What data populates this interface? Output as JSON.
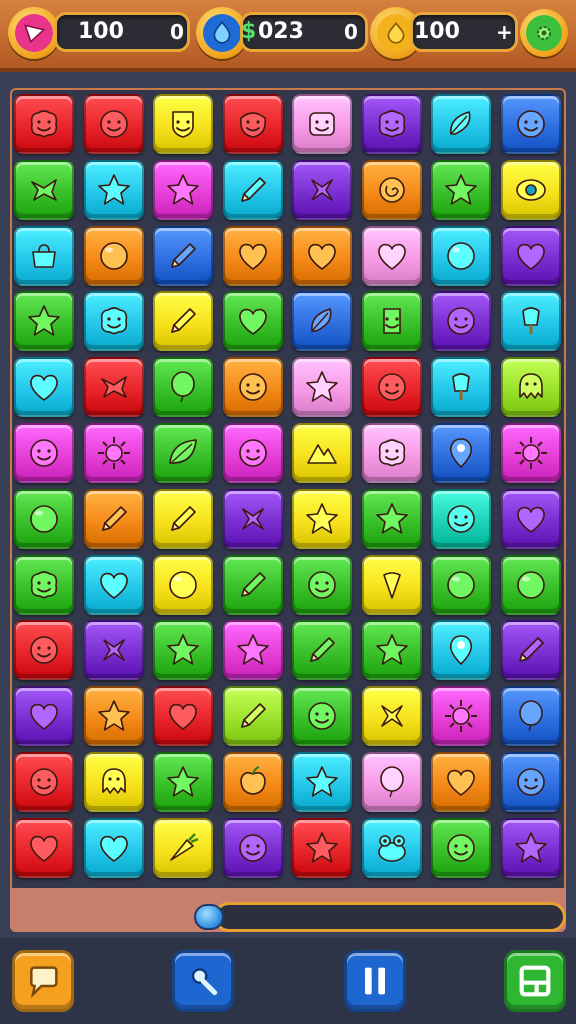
{
  "hud": {
    "moves_value": "100",
    "moves_end": "0",
    "gems_value": "023",
    "gems_prefix": "$",
    "gems_end": "0",
    "coins_value": "100",
    "coins_end": "+"
  },
  "progress": {
    "fraction": 0.0
  },
  "colors": {
    "red": "#e8252a",
    "orange": "#f58a1a",
    "yellow": "#f7e21d",
    "green": "#39c02b",
    "cyan": "#25c7ea",
    "blue": "#2f6fe0",
    "purple": "#7a2fd0",
    "magenta": "#e640d8",
    "pink": "#f79be6",
    "lime": "#9be22d",
    "teal": "#1fd3b8"
  },
  "grid": [
    [
      {
        "bg": "red",
        "icon": "blob-face"
      },
      {
        "bg": "red",
        "icon": "round-face"
      },
      {
        "bg": "yellow",
        "icon": "shield-face"
      },
      {
        "bg": "red",
        "icon": "grin-face"
      },
      {
        "bg": "pink",
        "icon": "square-face"
      },
      {
        "bg": "purple",
        "icon": "blob-face"
      },
      {
        "bg": "cyan",
        "icon": "feather"
      },
      {
        "bg": "blue",
        "icon": "round-face"
      }
    ],
    [
      {
        "bg": "green",
        "icon": "bow"
      },
      {
        "bg": "cyan",
        "icon": "star"
      },
      {
        "bg": "magenta",
        "icon": "star"
      },
      {
        "bg": "cyan",
        "icon": "pencil"
      },
      {
        "bg": "purple",
        "icon": "cross"
      },
      {
        "bg": "orange",
        "icon": "spiral"
      },
      {
        "bg": "green",
        "icon": "star"
      },
      {
        "bg": "yellow",
        "icon": "eye"
      }
    ],
    [
      {
        "bg": "cyan",
        "icon": "bag"
      },
      {
        "bg": "orange",
        "icon": "ball"
      },
      {
        "bg": "blue",
        "icon": "pencil"
      },
      {
        "bg": "orange",
        "icon": "heart"
      },
      {
        "bg": "orange",
        "icon": "heart"
      },
      {
        "bg": "pink",
        "icon": "heart"
      },
      {
        "bg": "cyan",
        "icon": "ball"
      },
      {
        "bg": "purple",
        "icon": "heart"
      }
    ],
    [
      {
        "bg": "green",
        "icon": "star"
      },
      {
        "bg": "cyan",
        "icon": "blob-face"
      },
      {
        "bg": "yellow",
        "icon": "pencil"
      },
      {
        "bg": "green",
        "icon": "heart"
      },
      {
        "bg": "blue",
        "icon": "feather"
      },
      {
        "bg": "green",
        "icon": "totem"
      },
      {
        "bg": "purple",
        "icon": "round-face"
      },
      {
        "bg": "cyan",
        "icon": "popsicle"
      }
    ],
    [
      {
        "bg": "cyan",
        "icon": "heart"
      },
      {
        "bg": "red",
        "icon": "bow"
      },
      {
        "bg": "green",
        "icon": "balloon"
      },
      {
        "bg": "orange",
        "icon": "round-face"
      },
      {
        "bg": "pink",
        "icon": "star"
      },
      {
        "bg": "red",
        "icon": "round-face"
      },
      {
        "bg": "cyan",
        "icon": "popsicle"
      },
      {
        "bg": "lime",
        "icon": "octopus"
      }
    ],
    [
      {
        "bg": "magenta",
        "icon": "round-face"
      },
      {
        "bg": "magenta",
        "icon": "sun"
      },
      {
        "bg": "green",
        "icon": "leaf"
      },
      {
        "bg": "magenta",
        "icon": "round-face"
      },
      {
        "bg": "yellow",
        "icon": "mountain"
      },
      {
        "bg": "pink",
        "icon": "blob-face"
      },
      {
        "bg": "blue",
        "icon": "pin"
      },
      {
        "bg": "magenta",
        "icon": "sun"
      }
    ],
    [
      {
        "bg": "green",
        "icon": "ball"
      },
      {
        "bg": "orange",
        "icon": "pencil"
      },
      {
        "bg": "yellow",
        "icon": "pencil"
      },
      {
        "bg": "purple",
        "icon": "cross"
      },
      {
        "bg": "yellow",
        "icon": "star"
      },
      {
        "bg": "green",
        "icon": "star"
      },
      {
        "bg": "teal",
        "icon": "round-face"
      },
      {
        "bg": "purple",
        "icon": "heart"
      }
    ],
    [
      {
        "bg": "green",
        "icon": "blob-face"
      },
      {
        "bg": "cyan",
        "icon": "heart"
      },
      {
        "bg": "yellow",
        "icon": "ball"
      },
      {
        "bg": "green",
        "icon": "pencil"
      },
      {
        "bg": "green",
        "icon": "round-face"
      },
      {
        "bg": "yellow",
        "icon": "cone"
      },
      {
        "bg": "green",
        "icon": "ball"
      },
      {
        "bg": "green",
        "icon": "ball"
      }
    ],
    [
      {
        "bg": "red",
        "icon": "round-face"
      },
      {
        "bg": "purple",
        "icon": "cross"
      },
      {
        "bg": "green",
        "icon": "star"
      },
      {
        "bg": "magenta",
        "icon": "star"
      },
      {
        "bg": "green",
        "icon": "pencil"
      },
      {
        "bg": "green",
        "icon": "star"
      },
      {
        "bg": "cyan",
        "icon": "pin"
      },
      {
        "bg": "purple",
        "icon": "pencil"
      }
    ],
    [
      {
        "bg": "purple",
        "icon": "heart"
      },
      {
        "bg": "orange",
        "icon": "star"
      },
      {
        "bg": "red",
        "icon": "heart"
      },
      {
        "bg": "lime",
        "icon": "pencil"
      },
      {
        "bg": "green",
        "icon": "round-face"
      },
      {
        "bg": "yellow",
        "icon": "cross"
      },
      {
        "bg": "magenta",
        "icon": "sun"
      },
      {
        "bg": "blue",
        "icon": "balloon"
      }
    ],
    [
      {
        "bg": "red",
        "icon": "round-face"
      },
      {
        "bg": "yellow",
        "icon": "octopus"
      },
      {
        "bg": "green",
        "icon": "star"
      },
      {
        "bg": "orange",
        "icon": "apple"
      },
      {
        "bg": "cyan",
        "icon": "star"
      },
      {
        "bg": "pink",
        "icon": "balloon"
      },
      {
        "bg": "orange",
        "icon": "heart"
      },
      {
        "bg": "blue",
        "icon": "round-face"
      }
    ],
    [
      {
        "bg": "red",
        "icon": "heart"
      },
      {
        "bg": "cyan",
        "icon": "heart"
      },
      {
        "bg": "yellow",
        "icon": "carrot"
      },
      {
        "bg": "purple",
        "icon": "round-face"
      },
      {
        "bg": "red",
        "icon": "star"
      },
      {
        "bg": "cyan",
        "icon": "frog"
      },
      {
        "bg": "green",
        "icon": "round-face"
      },
      {
        "bg": "purple",
        "icon": "star"
      }
    ]
  ],
  "buttons": {
    "chat": {
      "color": "orange",
      "icon": "speech-bubble-icon"
    },
    "hint": {
      "color": "blue",
      "icon": "magic-wand-icon"
    },
    "pause": {
      "color": "blue",
      "icon": "pause-icon"
    },
    "menu": {
      "color": "green",
      "icon": "window-icon"
    }
  }
}
